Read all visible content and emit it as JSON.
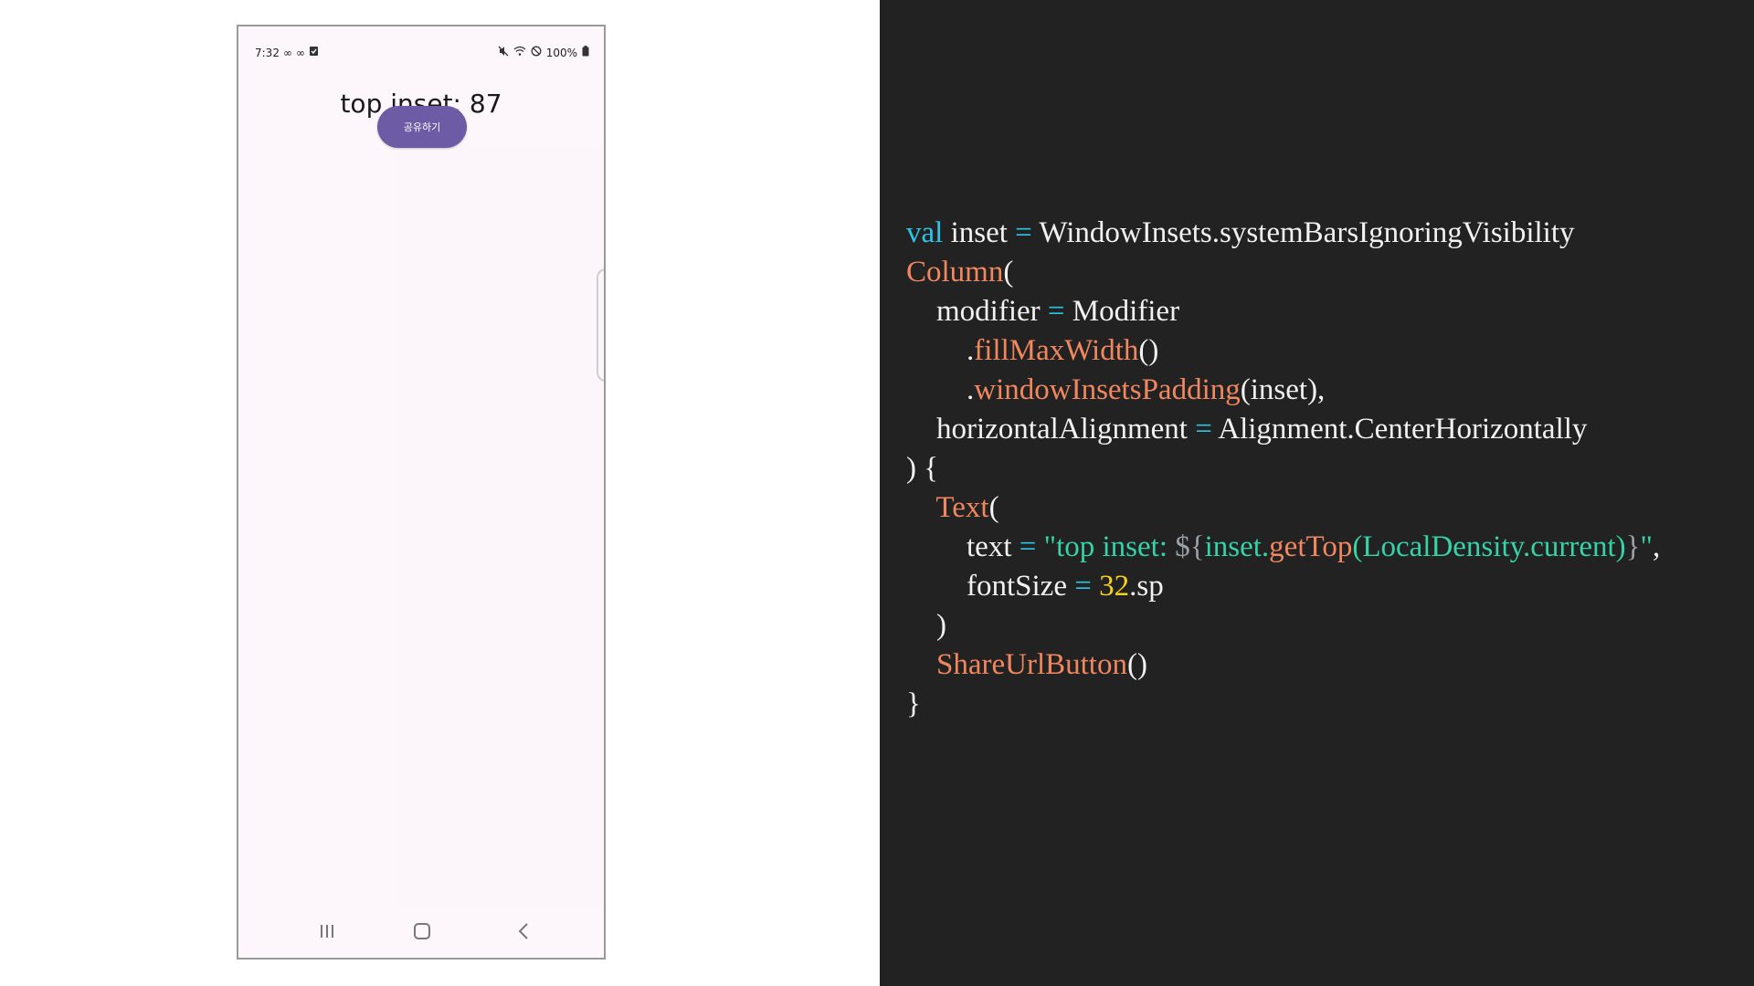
{
  "phone": {
    "status": {
      "time": "7:32",
      "battery": "100%",
      "left_icons": [
        "infinity-icon",
        "infinity-icon",
        "clipboard-check-icon"
      ],
      "right_icons": [
        "mute-icon",
        "wifi-icon",
        "do-not-disturb-icon",
        "battery-icon"
      ]
    },
    "title": "top inset: 87",
    "share_button_label": "공유하기",
    "nav_icons": [
      "recent-apps-icon",
      "home-icon",
      "back-icon"
    ]
  },
  "code": {
    "language": "kotlin",
    "lines": [
      [
        {
          "t": "kw",
          "v": "val"
        },
        {
          "t": "plain",
          "v": " inset "
        },
        {
          "t": "op",
          "v": "="
        },
        {
          "t": "plain",
          "v": " WindowInsets.systemBarsIgnoringVisibility"
        }
      ],
      [
        {
          "t": "fn",
          "v": "Column"
        },
        {
          "t": "plain",
          "v": "("
        }
      ],
      [
        {
          "t": "plain",
          "v": "    modifier "
        },
        {
          "t": "op",
          "v": "="
        },
        {
          "t": "plain",
          "v": " Modifier"
        }
      ],
      [
        {
          "t": "plain",
          "v": "        ."
        },
        {
          "t": "fn",
          "v": "fillMaxWidth"
        },
        {
          "t": "plain",
          "v": "()"
        }
      ],
      [
        {
          "t": "plain",
          "v": "        ."
        },
        {
          "t": "fn",
          "v": "windowInsetsPadding"
        },
        {
          "t": "plain",
          "v": "(inset),"
        }
      ],
      [
        {
          "t": "plain",
          "v": "    horizontalAlignment "
        },
        {
          "t": "op",
          "v": "="
        },
        {
          "t": "plain",
          "v": " Alignment.CenterHorizontally"
        }
      ],
      [
        {
          "t": "plain",
          "v": ") {"
        }
      ],
      [
        {
          "t": "plain",
          "v": "    "
        },
        {
          "t": "fn",
          "v": "Text"
        },
        {
          "t": "plain",
          "v": "("
        }
      ],
      [
        {
          "t": "plain",
          "v": "        text "
        },
        {
          "t": "op",
          "v": "="
        },
        {
          "t": "str",
          "v": " \"top inset: "
        },
        {
          "t": "tpl",
          "v": "${"
        },
        {
          "t": "str",
          "v": "inset."
        },
        {
          "t": "fn",
          "v": "getTop"
        },
        {
          "t": "str",
          "v": "(LocalDensity.current)"
        },
        {
          "t": "tpl",
          "v": "}"
        },
        {
          "t": "str",
          "v": "\""
        },
        {
          "t": "plain",
          "v": ","
        }
      ],
      [
        {
          "t": "plain",
          "v": "        fontSize "
        },
        {
          "t": "op",
          "v": "="
        },
        {
          "t": "num",
          "v": " 32"
        },
        {
          "t": "plain",
          "v": ".sp"
        }
      ],
      [
        {
          "t": "plain",
          "v": "    )"
        }
      ],
      [
        {
          "t": "plain",
          "v": "    "
        },
        {
          "t": "fn",
          "v": "ShareUrlButton"
        },
        {
          "t": "plain",
          "v": "()"
        }
      ],
      [
        {
          "t": "plain",
          "v": "}"
        }
      ]
    ]
  },
  "colors": {
    "code_background": "#222222",
    "keyword": "#2cc5e8",
    "function": "#f0875e",
    "string": "#35d3a5",
    "number": "#f5d21c",
    "button": "#6d5ba6"
  }
}
